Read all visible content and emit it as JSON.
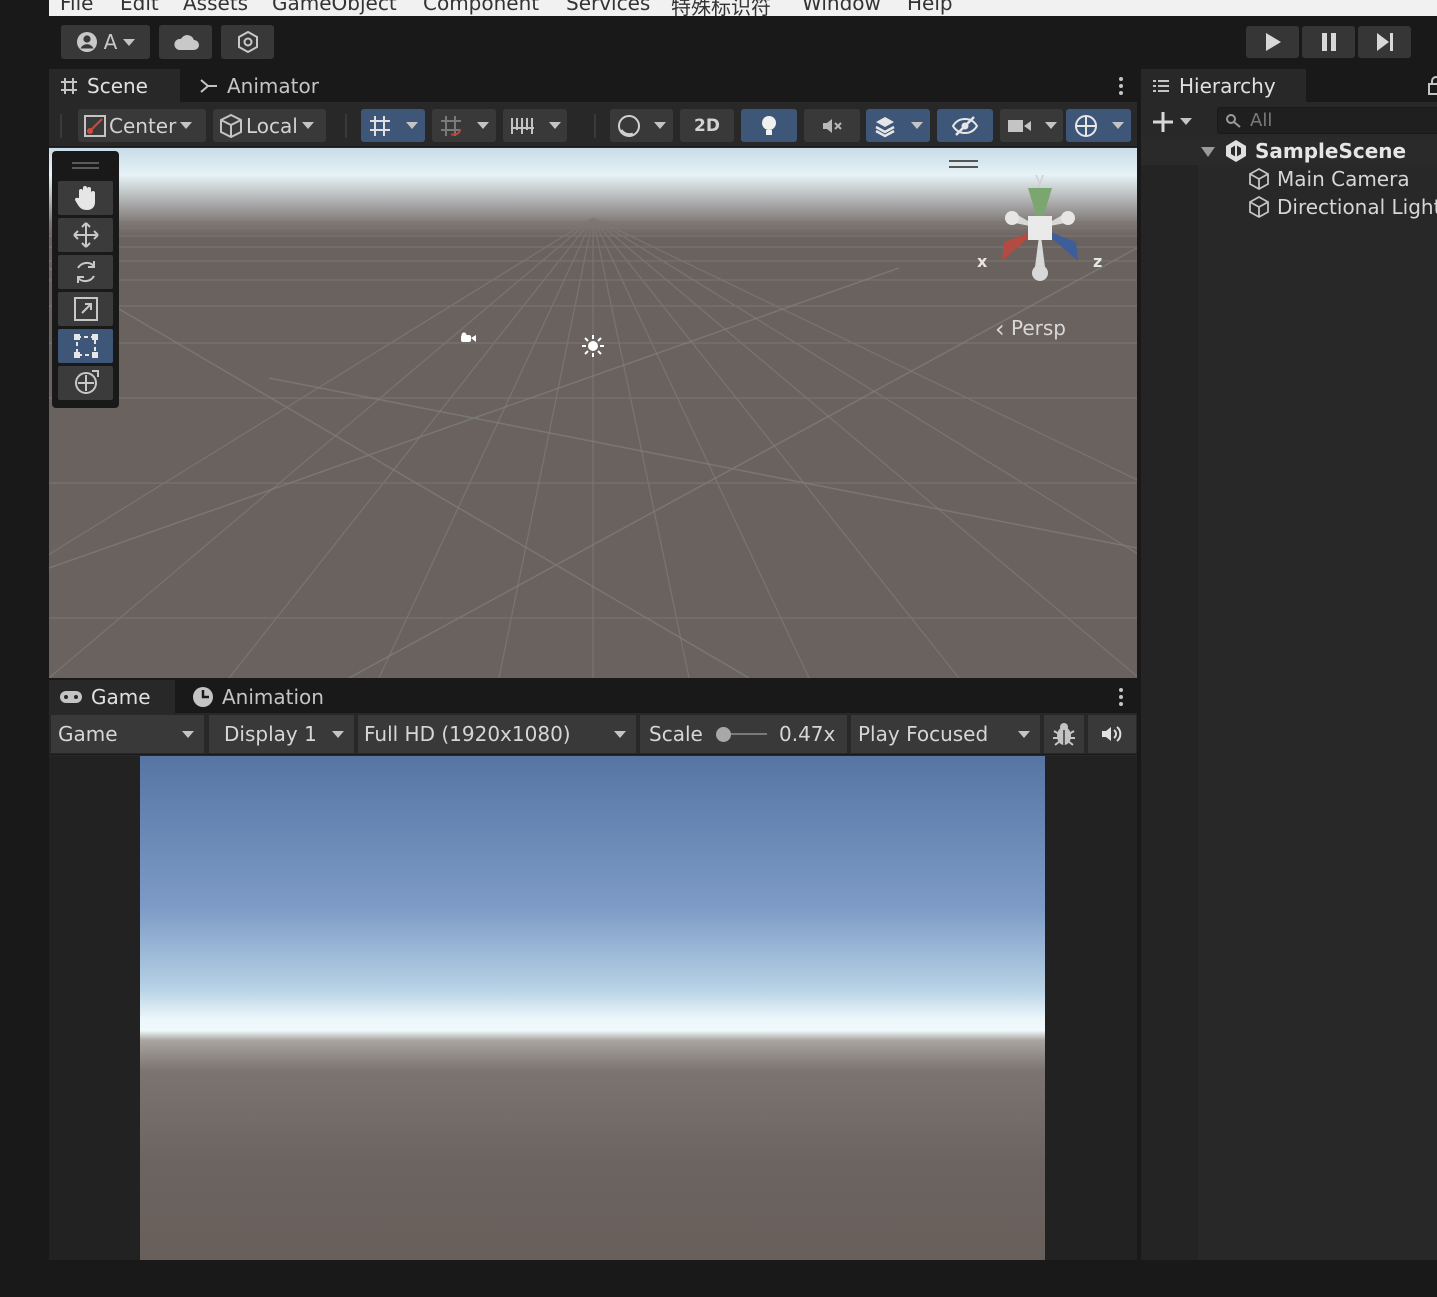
{
  "menu": [
    "File",
    "Edit",
    "Assets",
    "GameObject",
    "Component",
    "Services",
    "特殊标识符",
    "Window",
    "Help"
  ],
  "toolbar": {
    "account_label": "A",
    "play_icon": "play-icon",
    "pause_icon": "pause-icon",
    "step_icon": "step-icon"
  },
  "scene_panel": {
    "tabs": [
      {
        "label": "Scene",
        "icon": "grid-icon"
      },
      {
        "label": "Animator",
        "icon": "animator-icon"
      }
    ],
    "pivot": "Center",
    "space": "Local",
    "two_d": "2D",
    "view_label": "Persp",
    "gizmo_axes": {
      "x": "x",
      "y": "y",
      "z": "z"
    }
  },
  "game_panel": {
    "tabs": [
      {
        "label": "Game",
        "icon": "gamepad-icon"
      },
      {
        "label": "Animation",
        "icon": "clock-icon"
      }
    ],
    "mode": "Game",
    "display": "Display 1",
    "resolution": "Full HD (1920x1080)",
    "scale_label": "Scale",
    "scale_value": "0.47x",
    "play_mode": "Play Focused"
  },
  "hierarchy": {
    "tab": "Hierarchy",
    "search_placeholder": "All",
    "scene_name": "SampleScene",
    "items": [
      "Main Camera",
      "Directional Light"
    ]
  }
}
